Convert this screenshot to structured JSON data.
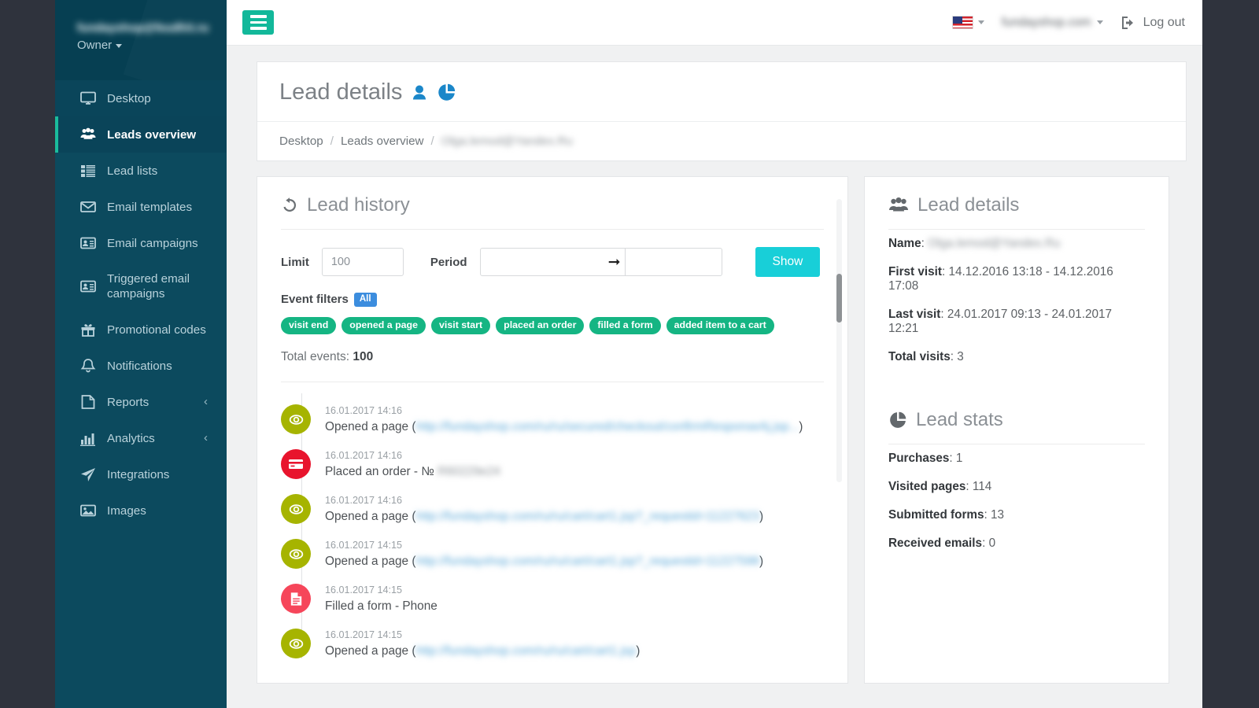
{
  "sidebar": {
    "user_email": "fundayshop@feudhit.ru",
    "user_role": "Owner",
    "items": [
      {
        "label": "Desktop",
        "icon": "desktop-icon",
        "active": false,
        "chevron": ""
      },
      {
        "label": "Leads overview",
        "icon": "users-icon",
        "active": true,
        "chevron": ""
      },
      {
        "label": "Lead lists",
        "icon": "list-icon",
        "active": false,
        "chevron": ""
      },
      {
        "label": "Email templates",
        "icon": "envelope-icon",
        "active": false,
        "chevron": ""
      },
      {
        "label": "Email campaigns",
        "icon": "id-card-icon",
        "active": false,
        "chevron": ""
      },
      {
        "label": "Triggered email campaigns",
        "icon": "id-card-icon",
        "active": false,
        "chevron": ""
      },
      {
        "label": "Promotional codes",
        "icon": "gift-icon",
        "active": false,
        "chevron": ""
      },
      {
        "label": "Notifications",
        "icon": "bell-icon",
        "active": false,
        "chevron": ""
      },
      {
        "label": "Reports",
        "icon": "file-icon",
        "active": false,
        "chevron": "‹"
      },
      {
        "label": "Analytics",
        "icon": "bar-chart-icon",
        "active": false,
        "chevron": "‹"
      },
      {
        "label": "Integrations",
        "icon": "paper-plane-icon",
        "active": false,
        "chevron": ""
      },
      {
        "label": "Images",
        "icon": "image-icon",
        "active": false,
        "chevron": ""
      }
    ]
  },
  "topbar": {
    "menu_toggle": "hamburger-icon",
    "language_flag": "us-flag-icon",
    "domain": "fundayshop.com",
    "logout_label": "Log out"
  },
  "page": {
    "title": "Lead details",
    "breadcrumb": [
      "Desktop",
      "Leads overview",
      "Olga.lemod@Yandex.Ru"
    ]
  },
  "history": {
    "heading": "Lead history",
    "limit_label": "Limit",
    "limit_value": "100",
    "period_label": "Period",
    "period_from": "",
    "period_to": "",
    "period_placeholder": "",
    "show_label": "Show",
    "event_filters_label": "Event filters",
    "all_badge": "All",
    "chips": [
      "visit end",
      "opened a page",
      "visit start",
      "placed an order",
      "filled a form",
      "added item to a cart"
    ],
    "total_events_label": "Total events:",
    "total_events_value": "100",
    "events": [
      {
        "time": "16.01.2017 14:16",
        "icon": "eye-icon",
        "kind": "eye",
        "text": "Opened a page (",
        "url": "http://fundayshop.com/ru/ru/secured/checkout/confirmResponseAj.jsp...",
        "suffix": ")"
      },
      {
        "time": "16.01.2017 14:16",
        "icon": "credit-card-icon",
        "kind": "order",
        "text": "Placed an order - № ",
        "url": "R60229e24",
        "suffix": ""
      },
      {
        "time": "16.01.2017 14:16",
        "icon": "eye-icon",
        "kind": "eye",
        "text": "Opened a page (",
        "url": "http://fundayshop.com/ru/ru/cart/cart1.jsp?_requestid=11227623",
        "suffix": ")"
      },
      {
        "time": "16.01.2017 14:15",
        "icon": "eye-icon",
        "kind": "eye",
        "text": "Opened a page (",
        "url": "http://fundayshop.com/ru/ru/cart/cart1.jsp?_requestid=11227598",
        "suffix": ")"
      },
      {
        "time": "16.01.2017 14:15",
        "icon": "document-icon",
        "kind": "form",
        "text": "Filled a form - Phone",
        "url": "",
        "suffix": ""
      },
      {
        "time": "16.01.2017 14:15",
        "icon": "eye-icon",
        "kind": "eye",
        "text": "Opened a page (",
        "url": "http://fundayshop.com/ru/ru/cart/cart1.jsp",
        "suffix": ")"
      }
    ]
  },
  "details": {
    "heading": "Lead details",
    "rows": [
      {
        "key": "Name",
        "value": "Olga.lemod@Yandex.Ru",
        "blur": true
      },
      {
        "key": "First visit",
        "value": "14.12.2016 13:18 - 14.12.2016 17:08",
        "blur": false
      },
      {
        "key": "Last visit",
        "value": "24.01.2017 09:13 - 24.01.2017 12:21",
        "blur": false
      },
      {
        "key": "Total visits",
        "value": "3",
        "blur": false
      }
    ]
  },
  "stats": {
    "heading": "Lead stats",
    "rows": [
      {
        "key": "Purchases",
        "value": "1"
      },
      {
        "key": "Visited pages",
        "value": "114"
      },
      {
        "key": "Submitted forms",
        "value": "13"
      },
      {
        "key": "Received emails",
        "value": "0"
      }
    ]
  },
  "colors": {
    "sidebar_bg": "#0c4a5e",
    "accent_teal": "#12b89a",
    "button_cyan": "#18cfd8",
    "chip_green": "#15b583",
    "badge_blue": "#3c8dde",
    "eye_olive": "#a6b400",
    "order_red": "#e8142d",
    "form_red": "#f6465a"
  }
}
